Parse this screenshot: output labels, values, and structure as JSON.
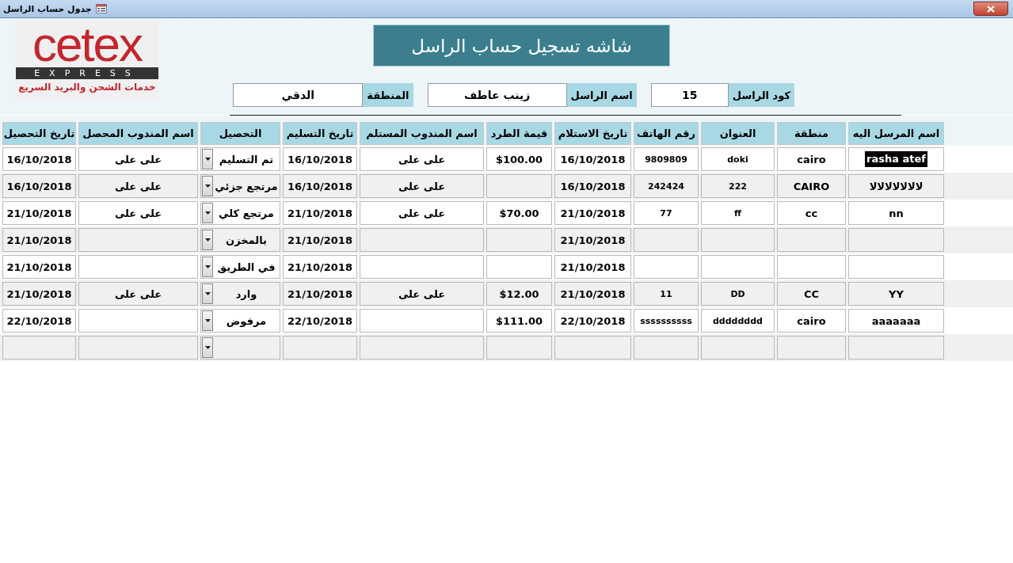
{
  "window": {
    "title": "جدول حساب الراسل"
  },
  "logo": {
    "brand": "cetex",
    "subtitle": "EXPRESS",
    "tagline": "خدمات الشحن والبريد السريع"
  },
  "form_title": "شاشه تسجيل حساب الراسل",
  "fields": [
    {
      "label": "كود الراسل",
      "value": "15"
    },
    {
      "label": "اسم الراسل",
      "value": "زينب عاطف"
    },
    {
      "label": "المنطقة",
      "value": "الدقي"
    }
  ],
  "table": {
    "columns": [
      {
        "label": "اسم المرسل اليه",
        "kind": "text"
      },
      {
        "label": "منطقة",
        "kind": "text"
      },
      {
        "label": "العنوان",
        "kind": "text"
      },
      {
        "label": "رقم الهاتف",
        "kind": "text"
      },
      {
        "label": "تاريخ الاستلام",
        "kind": "text"
      },
      {
        "label": "قيمة الطرد",
        "kind": "text"
      },
      {
        "label": "اسم المندوب المستلم",
        "kind": "text"
      },
      {
        "label": "تاريخ التسليم",
        "kind": "text"
      },
      {
        "label": "التحصيل",
        "kind": "combo"
      },
      {
        "label": "اسم المندوب المحصل",
        "kind": "text"
      },
      {
        "label": "تاريخ التحصيل",
        "kind": "text"
      }
    ],
    "rows": [
      {
        "name_highlighted": true,
        "cells": [
          "rasha atef",
          "cairo",
          "doki",
          "9809809",
          "16/10/2018",
          "$100.00",
          "على على",
          "16/10/2018",
          "تم التسليم",
          "على على",
          "16/10/2018"
        ]
      },
      {
        "name_highlighted": false,
        "cells": [
          "لالالالالالالا",
          "CAIRO",
          "222",
          "242424",
          "16/10/2018",
          null,
          "على على",
          "16/10/2018",
          "مرتجع جزئي",
          "على على",
          "16/10/2018"
        ]
      },
      {
        "name_highlighted": false,
        "cells": [
          "nn",
          "cc",
          "ff",
          "77",
          "21/10/2018",
          "$70.00",
          "على على",
          "21/10/2018",
          "مرتجع كلي",
          "على على",
          "21/10/2018"
        ]
      },
      {
        "name_highlighted": false,
        "cells": [
          null,
          null,
          null,
          null,
          "21/10/2018",
          null,
          null,
          "21/10/2018",
          "بالمخزن",
          null,
          "21/10/2018"
        ]
      },
      {
        "name_highlighted": false,
        "cells": [
          null,
          null,
          null,
          null,
          "21/10/2018",
          null,
          null,
          "21/10/2018",
          "في الطريق",
          null,
          "21/10/2018"
        ]
      },
      {
        "name_highlighted": false,
        "cells": [
          "YY",
          "CC",
          "DD",
          "11",
          "21/10/2018",
          "$12.00",
          "على على",
          "21/10/2018",
          "وارد",
          "على على",
          "21/10/2018"
        ]
      },
      {
        "name_highlighted": false,
        "cells": [
          "aaaaaaa",
          "cairo",
          "dddddddd",
          "ssssssssss",
          "22/10/2018",
          "$111.00",
          null,
          "22/10/2018",
          "مرفوض",
          null,
          "22/10/2018"
        ]
      },
      {
        "name_highlighted": false,
        "cells": [
          null,
          null,
          null,
          null,
          null,
          null,
          null,
          null,
          null,
          null,
          null
        ]
      }
    ]
  }
}
